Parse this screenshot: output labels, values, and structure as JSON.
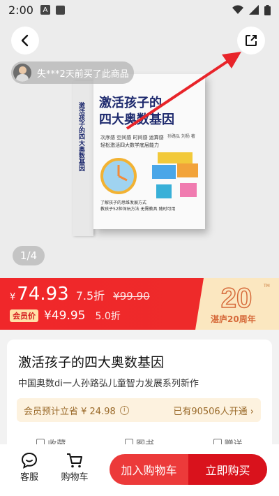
{
  "status_bar": {
    "time": "2:00",
    "badge_letter": "A"
  },
  "header": {
    "back_icon": "back-arrow-icon",
    "share_icon": "share-icon"
  },
  "hero": {
    "buyer_notice": "失***2天前买了此商品",
    "page_indicator": "1/4",
    "book": {
      "title_line1": "激活孩子的",
      "title_line2": "四大奥数基因",
      "subtitle_line1": "次序感 空间感 时间感 运算感",
      "subtitle_line2": "轻松激活四大数学底层能力",
      "author": "孙路弘 刘杨 著",
      "tagline_line1": "了解孩子的思维发展方式",
      "tagline_line2": "教孩子52种深玩方法 无需教具 随时可用",
      "spine": "激活孩子的四大奥数基因"
    }
  },
  "price": {
    "yen": "¥",
    "current": "74.93",
    "discount": "7.5折",
    "original": "¥99.90",
    "member_badge": "会员价",
    "member_price": "¥49.95",
    "member_discount": "5.0折",
    "anniversary": "湛庐20周年",
    "anniversary_number": "20",
    "anniversary_tm": "TM"
  },
  "product": {
    "title": "激活孩子的四大奥数基因",
    "subtitle": "中国奥数di一人孙路弘儿童智力发展系列新作",
    "member_save": "会员预计立省 ¥ 24.98",
    "member_info_icon": "i",
    "member_opened": "已有90506人开通 ›",
    "actions": [
      "收藏",
      "图书",
      "赠送"
    ]
  },
  "bottom_bar": {
    "service_label": "客服",
    "cart_label": "购物车",
    "add_to_cart": "加入购物车",
    "buy_now": "立即购买"
  },
  "colors": {
    "accent_red": "#ee2a2a",
    "buy_red": "#d9121c",
    "gold_bg": "#fdf2df"
  }
}
